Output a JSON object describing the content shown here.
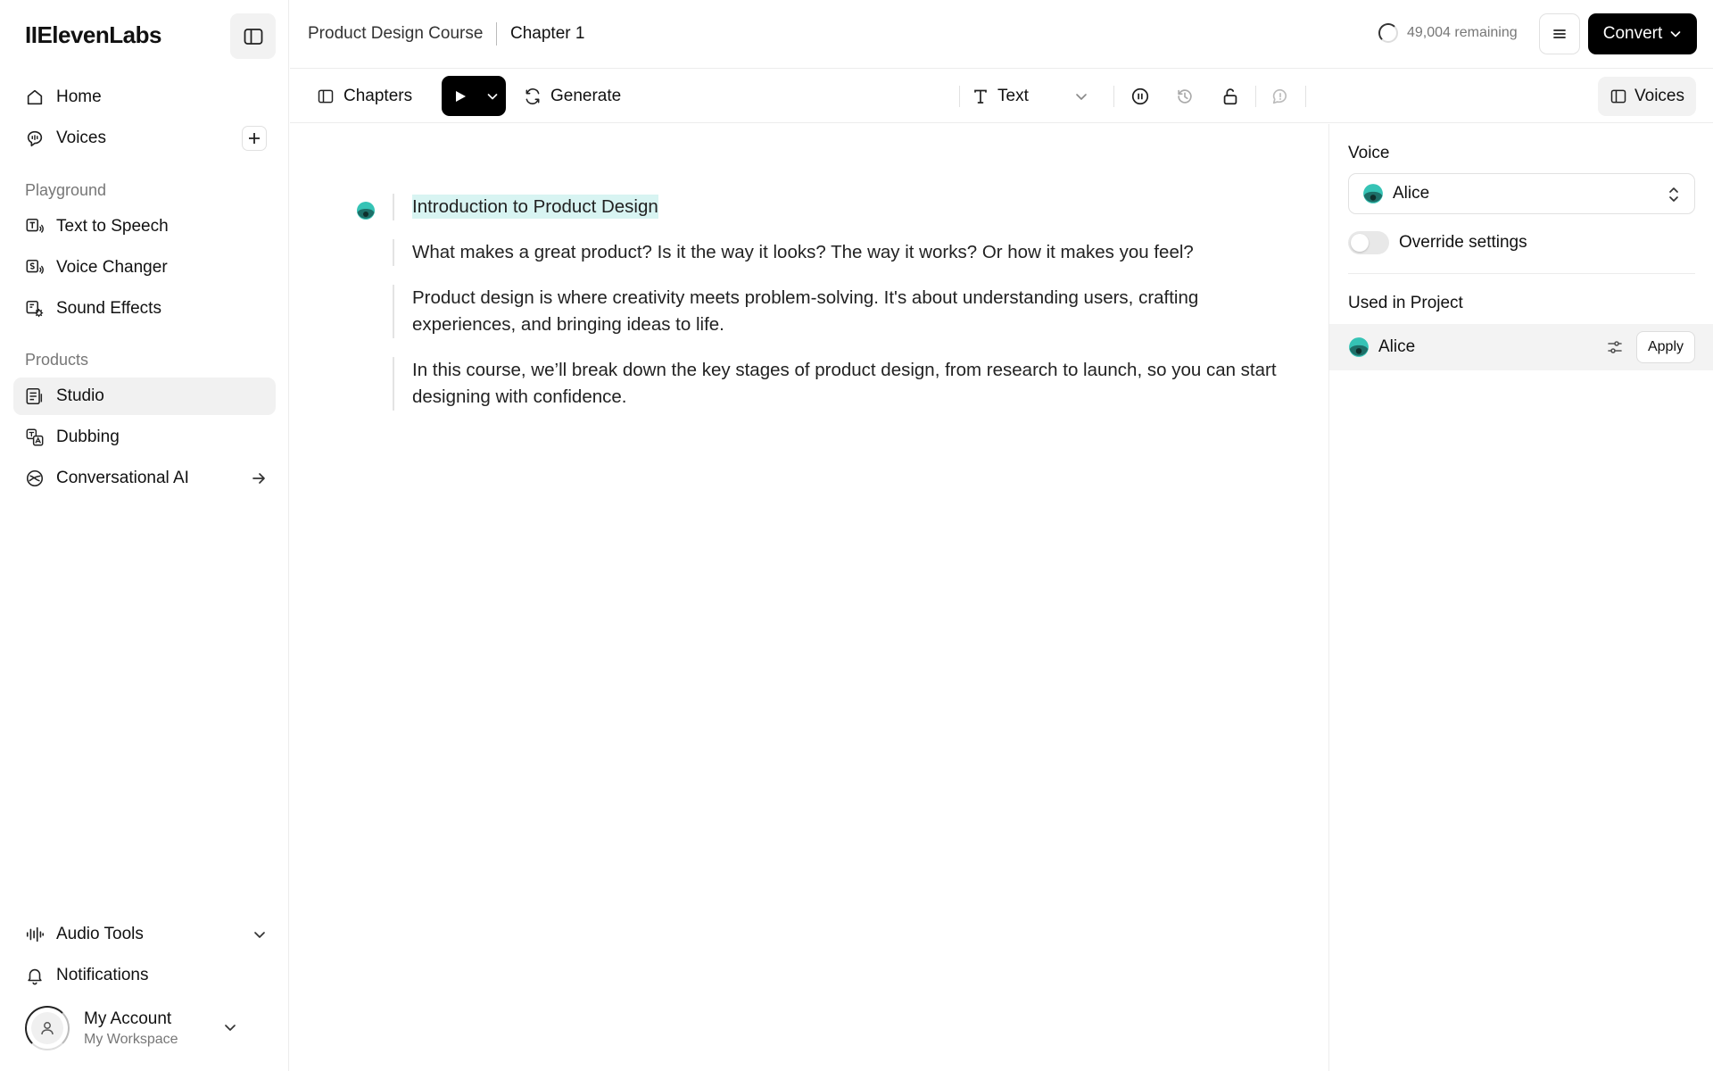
{
  "app": {
    "logo": "IIElevenLabs"
  },
  "sidebar": {
    "top_items": [
      {
        "label": "Home",
        "icon": "home-icon"
      },
      {
        "label": "Voices",
        "icon": "voices-icon"
      }
    ],
    "playground_label": "Playground",
    "playground_items": [
      {
        "label": "Text to Speech",
        "icon": "text-to-speech-icon"
      },
      {
        "label": "Voice Changer",
        "icon": "voice-changer-icon"
      },
      {
        "label": "Sound Effects",
        "icon": "sound-effects-icon"
      }
    ],
    "products_label": "Products",
    "products_items": [
      {
        "label": "Studio",
        "icon": "studio-icon",
        "active": true
      },
      {
        "label": "Dubbing",
        "icon": "dubbing-icon"
      },
      {
        "label": "Conversational AI",
        "icon": "conversational-ai-icon"
      }
    ],
    "bottom_items": [
      {
        "label": "Audio Tools",
        "icon": "audio-tools-icon"
      },
      {
        "label": "Notifications",
        "icon": "bell-icon"
      }
    ],
    "account": {
      "name": "My Account",
      "workspace": "My Workspace"
    }
  },
  "header": {
    "project": "Product Design Course",
    "chapter": "Chapter 1",
    "remaining": "49,004 remaining",
    "convert_label": "Convert"
  },
  "toolbar": {
    "chapters_label": "Chapters",
    "generate_label": "Generate",
    "text_label": "Text",
    "voices_label": "Voices"
  },
  "editor": {
    "title": "Introduction to Product Design",
    "paragraphs": [
      "What makes a great product? Is it the way it looks? The way it works? Or how it makes you feel?",
      "Product design is where creativity meets problem-solving. It's about understanding users, crafting experiences, and bringing ideas to life.",
      "In this course, we’ll break down the key stages of product design, from research to launch, so you can start designing with confidence."
    ]
  },
  "voice_panel": {
    "voice_label": "Voice",
    "selected_voice": "Alice",
    "override_label": "Override settings",
    "override_on": false,
    "used_in_project_label": "Used in Project",
    "used_voices": [
      {
        "name": "Alice",
        "apply_label": "Apply"
      }
    ]
  },
  "colors": {
    "accent_black": "#000000",
    "highlight": "#d8f4f2",
    "avatar_teal": "#35c3b5"
  }
}
